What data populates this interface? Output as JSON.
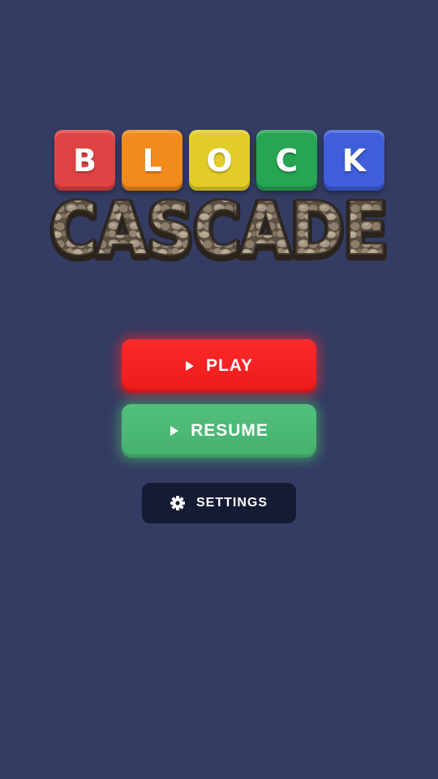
{
  "logo": {
    "tiles": [
      {
        "letter": "B",
        "color": "#e04343"
      },
      {
        "letter": "L",
        "color": "#f28b1c"
      },
      {
        "letter": "O",
        "color": "#e2cd28"
      },
      {
        "letter": "C",
        "color": "#26a552"
      },
      {
        "letter": "K",
        "color": "#3e5fd9"
      }
    ],
    "wordmark": "CASCADE"
  },
  "menu": {
    "play_label": "PLAY",
    "resume_label": "RESUME",
    "settings_label": "SETTINGS"
  },
  "colors": {
    "background": "#343c63",
    "play": "#ff2a2a",
    "resume": "#4fbd78",
    "settings": "#151b33"
  },
  "icons": {
    "play": "play-triangle-icon",
    "resume": "play-triangle-icon",
    "settings": "gear-icon"
  }
}
